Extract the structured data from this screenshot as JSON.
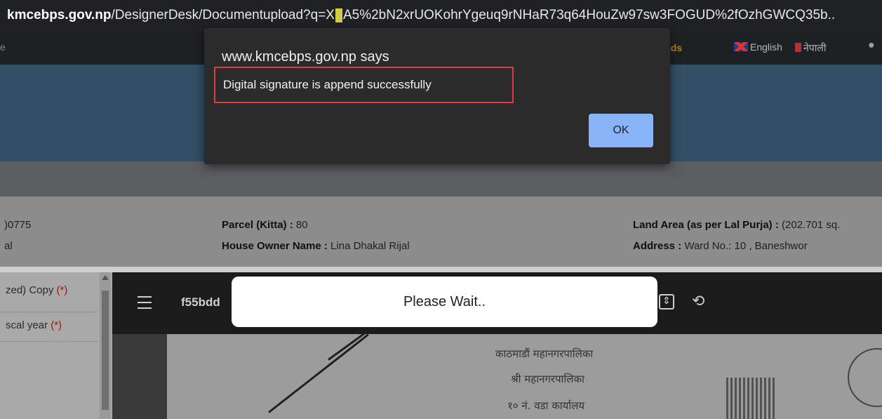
{
  "browser": {
    "url_host": "kmcebps.gov.np",
    "url_path_before_cursor": "/DesignerDesk/Documentupload?q=X",
    "url_path_after_cursor": "A5%2bN2xrUOKohrYgeuq9rNHaR73q64HouZw97sw3FOGUD%2fOzhGWCQ35b.."
  },
  "topnav": {
    "left_fragment": "e",
    "downloads_fragment": "ads",
    "lang_english": "English",
    "lang_nepali": "नेपाली",
    "flag_uk": "uk-flag-icon",
    "flag_np": "nepal-flag-icon"
  },
  "info": {
    "id_fragment": ")0775",
    "name_fragment": "al",
    "parcel_label": "Parcel (Kitta) :",
    "parcel_value": "80",
    "owner_label": "House Owner Name :",
    "owner_value": "Lina Dhakal Rijal",
    "land_area_label": "Land Area (as per Lal Purja) :",
    "land_area_value": "(202.701 sq.",
    "address_label": "Address :",
    "address_value": "Ward No.: 10 , Baneshwor"
  },
  "sidebar": {
    "items": [
      {
        "label": "zed) Copy",
        "required": "(*)"
      },
      {
        "label": "scal year",
        "required": "(*)"
      }
    ]
  },
  "viewer": {
    "file_name": "f55bdd",
    "doc_lines": [
      "काठमाडौं महानगरपालिका",
      "श्री महानगरपालिका",
      "१० नं. वडा कार्यालय"
    ]
  },
  "wait_text": "Please Wait..",
  "dialog": {
    "title": "www.kmcebps.gov.np says",
    "message": "Digital signature is append successfully",
    "ok_label": "OK"
  },
  "colors": {
    "dialog_bg": "#2b2b2b",
    "ok_button": "#8ab4f8",
    "highlight_border": "#e03c3c",
    "banner": "#324f66"
  }
}
